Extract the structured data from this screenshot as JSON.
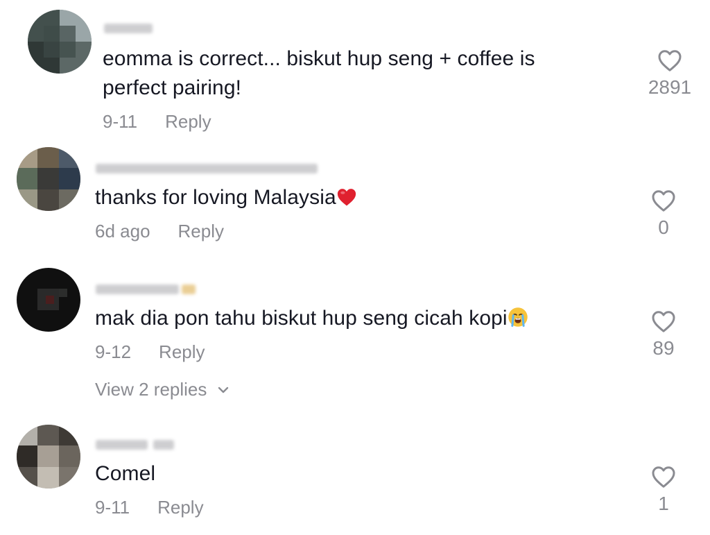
{
  "comments": [
    {
      "text": "eomma is correct... biskut hup seng + coffee is perfect pairing!",
      "date": "9-11",
      "reply_label": "Reply",
      "like_count": "2891"
    },
    {
      "text": "thanks for loving Malaysia",
      "emoji": "red-heart",
      "date": "6d ago",
      "reply_label": "Reply",
      "like_count": "0"
    },
    {
      "text": "mak dia pon tahu biskut hup seng cicah kopi",
      "emoji": "loudly-crying-face",
      "date": "9-12",
      "reply_label": "Reply",
      "like_count": "89",
      "view_replies_label": "View 2 replies"
    },
    {
      "text": "Comel",
      "date": "9-11",
      "reply_label": "Reply",
      "like_count": "1"
    }
  ],
  "colors": {
    "text": "#161823",
    "secondary": "#8a8b91"
  },
  "icons": {
    "like": "heart-outline-icon",
    "expand": "chevron-down-icon"
  }
}
